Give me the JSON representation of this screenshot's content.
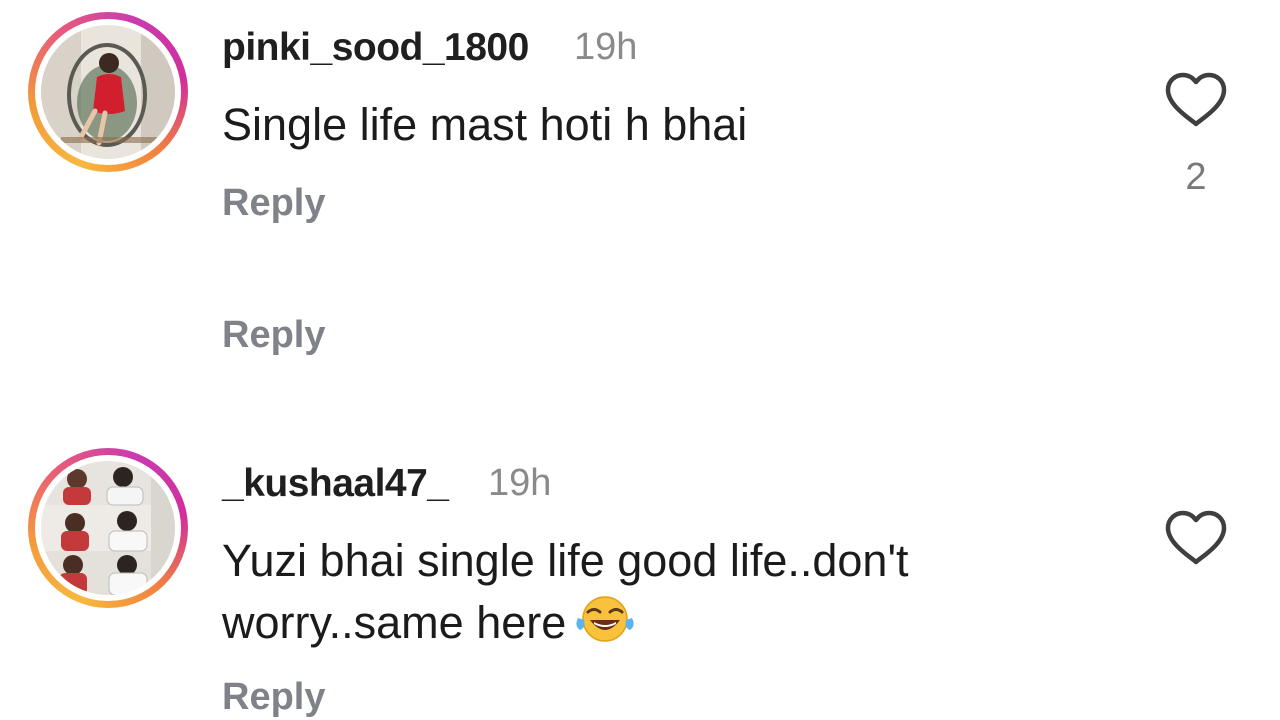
{
  "comments": [
    {
      "username": "pinki_sood_1800",
      "time": "19h",
      "text": "Single life mast hoti h bhai",
      "reply_label": "Reply",
      "like_count": "2",
      "heart_icon": "heart-outline-icon"
    },
    {
      "reply_label": "Reply"
    },
    {
      "username": "_kushaal47_",
      "time": "19h",
      "text_line1": "Yuzi bhai single life good life..don't",
      "text_line2": "worry..same here",
      "emoji": "face-with-tears-of-joy-icon",
      "reply_label": "Reply",
      "heart_icon": "heart-outline-icon"
    }
  ],
  "colors": {
    "reply_gray": "#7f8288",
    "time_gray": "#8a8a8a",
    "story_ring_start": "#f8b83f",
    "story_ring_end": "#d22e9b"
  }
}
